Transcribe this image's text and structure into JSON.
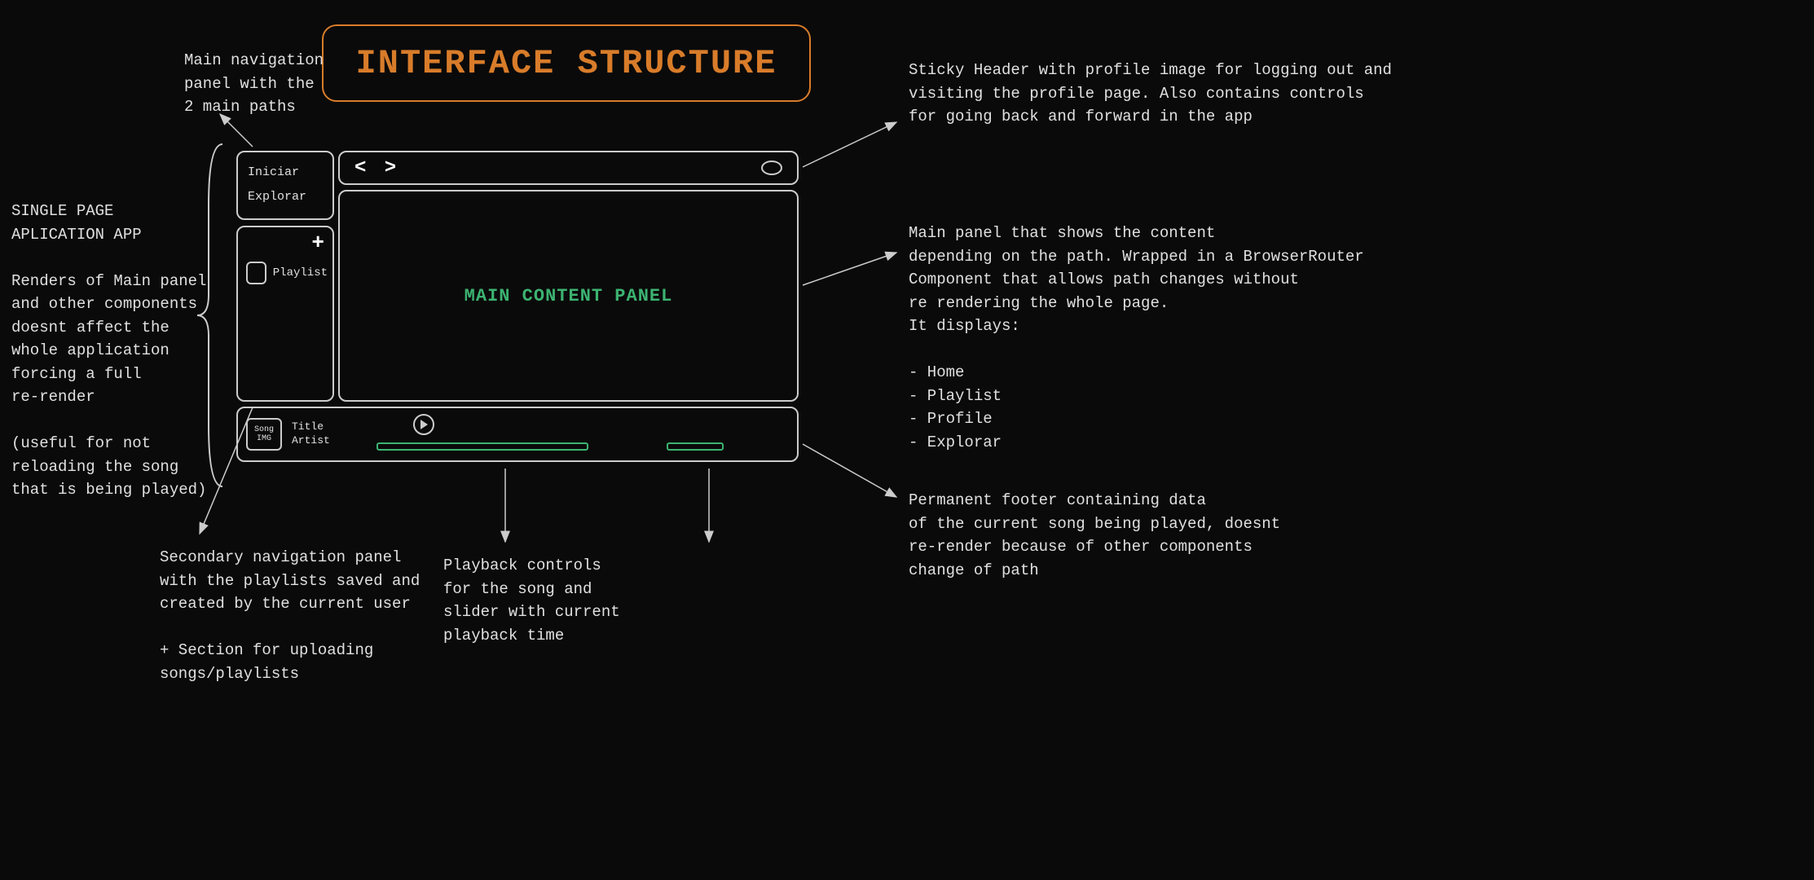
{
  "title": "INTERFACE STRUCTURE",
  "annotations": {
    "nav_panel": "Main navigation\npanel with the\n2 main paths",
    "spa": "SINGLE PAGE\nAPLICATION APP\n\nRenders of Main panel\nand other components\ndoesnt affect the\nwhole application\nforcing a full\nre-render\n\n(useful for not\nreloading the song\nthat is being played)",
    "header": "Sticky Header with profile image for logging out and\nvisiting the profile page. Also contains controls\nfor going back and forward in the app",
    "main_panel": "Main panel that shows the content\ndepending on the path. Wrapped in a BrowserRouter\nComponent that allows path changes without\nre rendering the whole page.\nIt displays:\n\n- Home\n- Playlist\n- Profile\n- Explorar",
    "footer": "Permanent footer containing data\nof the current song being played, doesnt\nre-render because of other components\nchange of path",
    "sidebar": "Secondary navigation panel\nwith the playlists saved and\ncreated by the current user\n\n+ Section for uploading\nsongs/playlists",
    "playback": "Playback controls\nfor the song and\nslider with current\nplayback time"
  },
  "app": {
    "nav": {
      "item1": "Iniciar",
      "item2": "Explorar"
    },
    "main_text": "MAIN CONTENT PANEL",
    "sidebar": {
      "playlist_label": "Playlist"
    },
    "footer": {
      "song_img": "Song\nIMG",
      "title": "Title",
      "artist": "Artist"
    }
  }
}
